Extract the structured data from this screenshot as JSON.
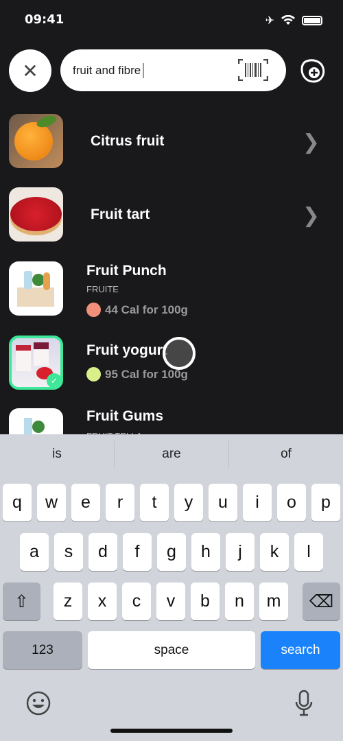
{
  "status": {
    "time": "09:41",
    "icons": [
      "airplane-icon",
      "wifi-icon",
      "battery-icon"
    ]
  },
  "search": {
    "value": "fruit and fibre",
    "close_icon": "close-icon",
    "barcode_icon": "barcode-scan-icon",
    "add_icon": "add-food-icon"
  },
  "results": [
    {
      "title": "Citrus fruit",
      "type": "category"
    },
    {
      "title": "Fruit tart",
      "type": "category"
    },
    {
      "title": "Fruit Punch",
      "brand": "FRUITE",
      "calories": "44 Cal for 100g",
      "rating": "bad",
      "rating_color": "#f0907a"
    },
    {
      "title": "Fruit yogurt",
      "calories": "95 Cal for 100g",
      "rating": "good",
      "rating_color": "#d9ef8a",
      "selected": true,
      "accent": "#3ee89a"
    },
    {
      "title": "Fruit Gums",
      "brand": "FRUIT TELLA"
    }
  ],
  "keyboard": {
    "suggestions": [
      "is",
      "are",
      "of"
    ],
    "row1": [
      "q",
      "w",
      "e",
      "r",
      "t",
      "y",
      "u",
      "i",
      "o",
      "p"
    ],
    "row2": [
      "a",
      "s",
      "d",
      "f",
      "g",
      "h",
      "j",
      "k",
      "l"
    ],
    "row3": [
      "z",
      "x",
      "c",
      "v",
      "b",
      "n",
      "m"
    ],
    "numbers": "123",
    "space": "space",
    "search": "search"
  }
}
